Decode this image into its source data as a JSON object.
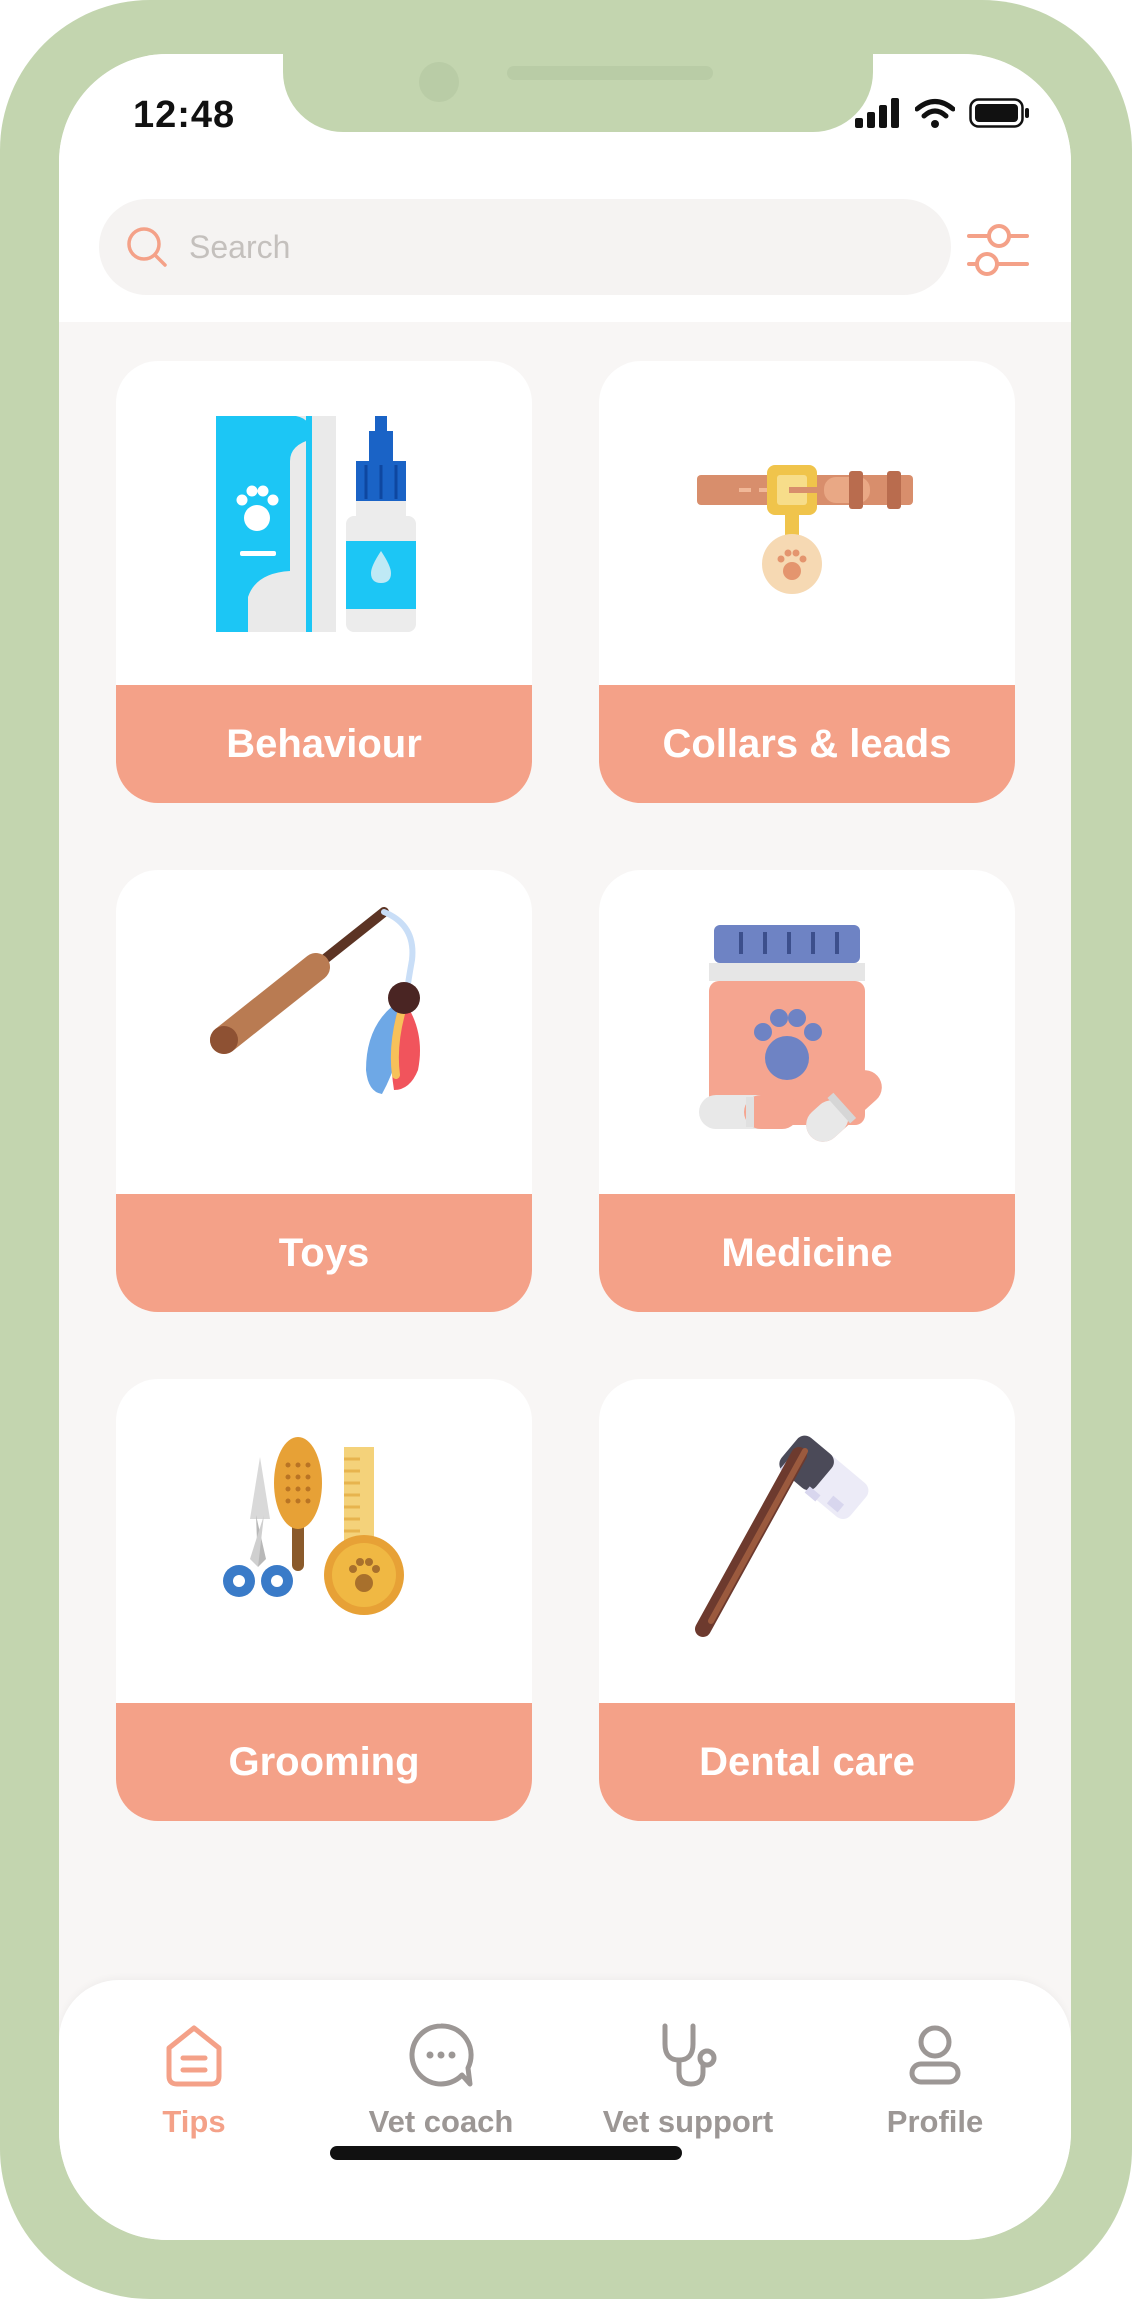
{
  "status_bar": {
    "time": "12:48"
  },
  "search": {
    "placeholder": "Search"
  },
  "categories": [
    {
      "label": "Behaviour",
      "icon": "pet-book-and-bottle-icon"
    },
    {
      "label": "Collars & leads",
      "icon": "collar-icon"
    },
    {
      "label": "Toys",
      "icon": "feather-wand-toy-icon"
    },
    {
      "label": "Medicine",
      "icon": "pet-medicine-jar-icon"
    },
    {
      "label": "Grooming",
      "icon": "grooming-tools-icon"
    },
    {
      "label": "Dental care",
      "icon": "toothbrush-icon"
    }
  ],
  "nav": {
    "items": [
      {
        "label": "Tips",
        "icon": "home-icon",
        "active": true
      },
      {
        "label": "Vet coach",
        "icon": "chat-bubble-icon",
        "active": false
      },
      {
        "label": "Vet support",
        "icon": "stethoscope-icon",
        "active": false
      },
      {
        "label": "Profile",
        "icon": "person-icon",
        "active": false
      }
    ]
  },
  "colors": {
    "frame": "#c3d5af",
    "accent": "#f4a188",
    "background": "#f8f6f5",
    "inactive": "#9c9795"
  }
}
